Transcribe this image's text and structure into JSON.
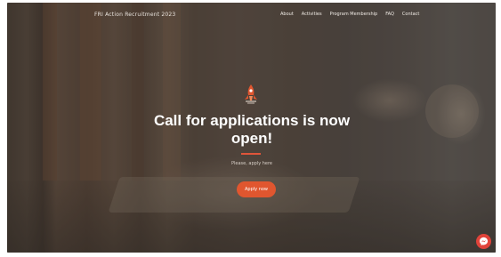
{
  "header": {
    "site_title": "FRI Action Recruitment 2023",
    "nav": [
      {
        "label": "About"
      },
      {
        "label": "Activities"
      },
      {
        "label": "Program Membership"
      },
      {
        "label": "FAQ"
      },
      {
        "label": "Contact"
      }
    ]
  },
  "hero": {
    "logo_icon": "rocket-flame-logo-icon",
    "headline": "Call for applications is now open!",
    "subtext": "Please, apply here",
    "apply_label": "Apply now",
    "accent_color": "#e0562f"
  },
  "chat": {
    "icon": "messenger-icon",
    "color": "#e0433a"
  }
}
